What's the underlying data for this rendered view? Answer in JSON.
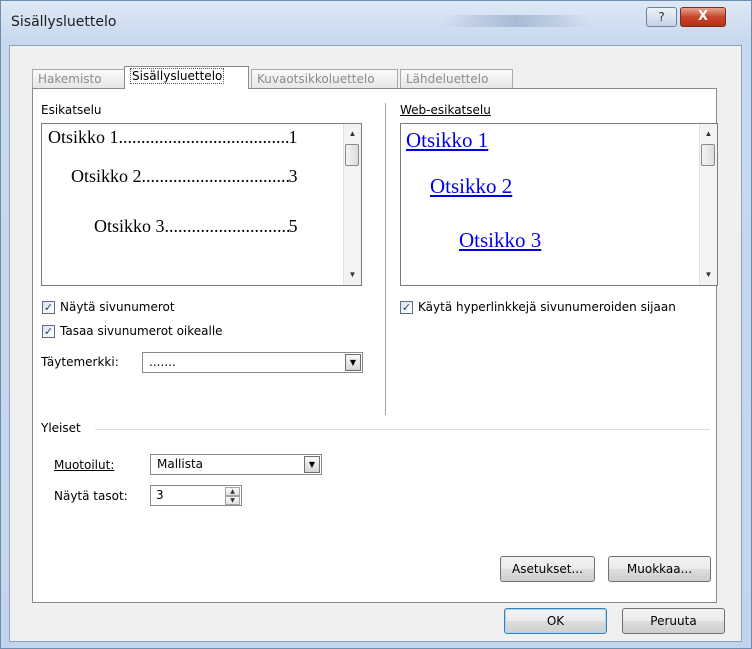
{
  "window": {
    "title": "Sisällysluettelo",
    "help_label": "?",
    "close_label": "X"
  },
  "tabs": [
    {
      "label": "Hakemisto",
      "active": false
    },
    {
      "label": "Sisällysluettelo",
      "active": true
    },
    {
      "label": "Kuvaotsikkoluettelo",
      "active": false
    },
    {
      "label": "Lähdeluettelo",
      "active": false
    }
  ],
  "print_preview": {
    "label": "Esikatselu",
    "lines": [
      {
        "text": "Otsikko 1",
        "page": "1"
      },
      {
        "text": "Otsikko 2",
        "page": "3"
      },
      {
        "text": "Otsikko 3",
        "page": "5"
      }
    ]
  },
  "web_preview": {
    "label": "Web-esikatselu",
    "links": [
      "Otsikko 1",
      "Otsikko 2",
      "Otsikko 3"
    ]
  },
  "options": {
    "show_page_numbers": {
      "label": "Näytä sivunumerot",
      "checked": true
    },
    "right_align": {
      "label": "Tasaa sivunumerot oikealle",
      "checked": true
    },
    "tab_leader": {
      "label": "Täytemerkki:",
      "value": "......."
    },
    "use_hyperlinks": {
      "label": "Käytä hyperlinkkejä sivunumeroiden sijaan",
      "checked": true
    }
  },
  "general": {
    "label": "Yleiset",
    "formats": {
      "label": "Muotoilut:",
      "value": "Mallista"
    },
    "show_levels": {
      "label": "Näytä tasot:",
      "value": "3"
    }
  },
  "buttons": {
    "settings": "Asetukset...",
    "modify": "Muokkaa...",
    "ok": "OK",
    "cancel": "Peruuta"
  },
  "icons": {
    "check": "✓",
    "arrow_down": "▼",
    "arrow_up": "▲"
  }
}
